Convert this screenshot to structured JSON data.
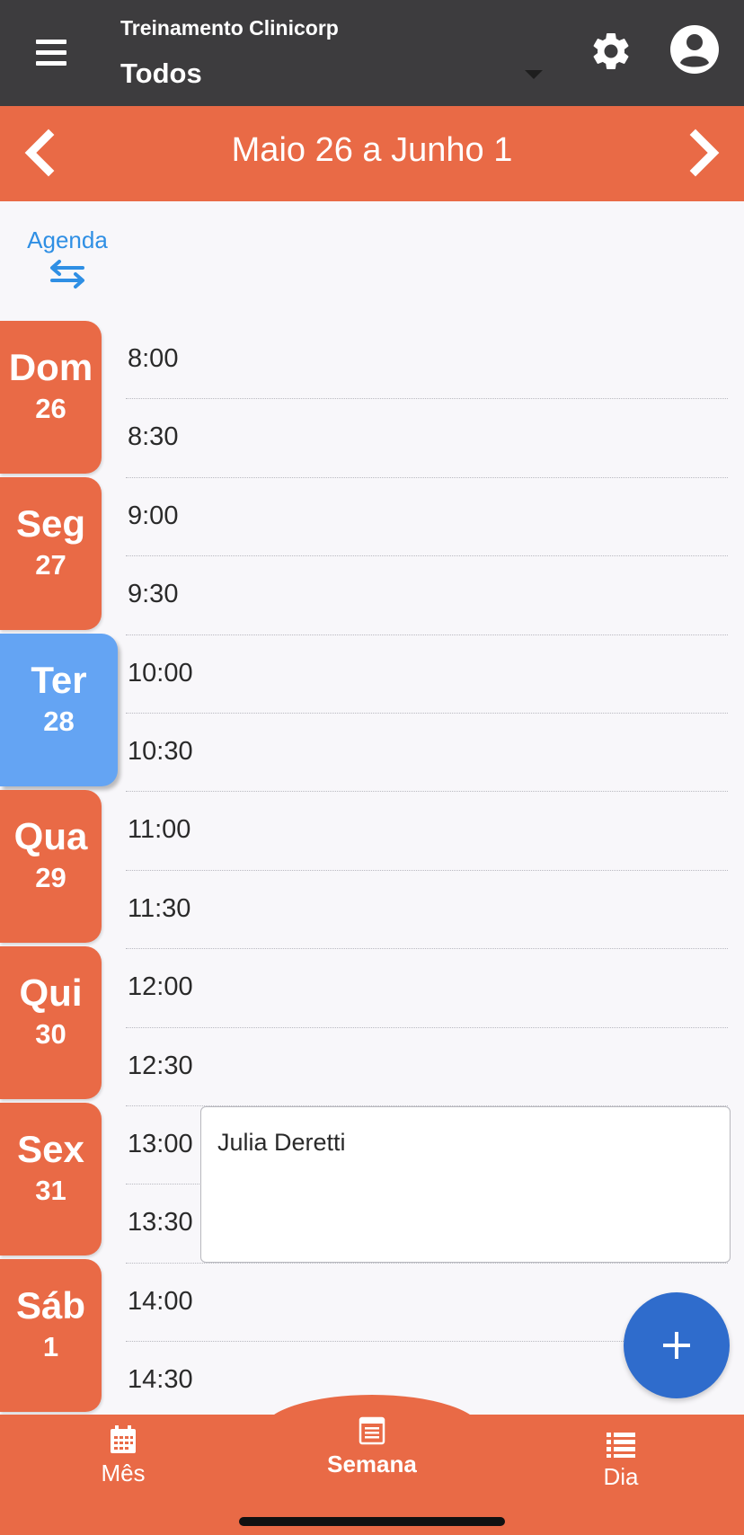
{
  "header": {
    "org_name": "Treinamento Clinicorp",
    "filter_value": "Todos",
    "menu_icon": "hamburger-menu-icon",
    "settings_icon": "gear-icon",
    "profile_icon": "user-circle-icon"
  },
  "week_nav": {
    "title": "Maio 26 a Junho 1",
    "prev_icon": "chevron-left-icon",
    "next_icon": "chevron-right-icon"
  },
  "agenda_toggle": {
    "label": "Agenda",
    "icon": "swap-arrows-icon"
  },
  "days": [
    {
      "name": "Dom",
      "number": "26",
      "active": false
    },
    {
      "name": "Seg",
      "number": "27",
      "active": false
    },
    {
      "name": "Ter",
      "number": "28",
      "active": true
    },
    {
      "name": "Qua",
      "number": "29",
      "active": false
    },
    {
      "name": "Qui",
      "number": "30",
      "active": false
    },
    {
      "name": "Sex",
      "number": "31",
      "active": false
    },
    {
      "name": "Sáb",
      "number": "1",
      "active": false
    }
  ],
  "time_slots": [
    "8:00",
    "8:30",
    "9:00",
    "9:30",
    "10:00",
    "10:30",
    "11:00",
    "11:30",
    "12:00",
    "12:30",
    "13:00",
    "13:30",
    "14:00",
    "14:30"
  ],
  "appointments": [
    {
      "patient": "Julia Deretti",
      "start": "13:00",
      "end": "14:00"
    }
  ],
  "fab": {
    "icon": "plus-icon"
  },
  "bottom_tabs": [
    {
      "label": "Mês",
      "icon": "calendar-month-icon",
      "selected": false
    },
    {
      "label": "Semana",
      "icon": "calendar-week-icon",
      "selected": true
    },
    {
      "label": "Dia",
      "icon": "list-icon",
      "selected": false
    }
  ],
  "colors": {
    "header_bg": "#3d3c3e",
    "accent_orange": "#e96a46",
    "active_day_blue": "#64a4f3",
    "link_blue": "#2f8fe4",
    "fab_blue": "#2f6ccc",
    "page_bg": "#f8f7fa"
  }
}
